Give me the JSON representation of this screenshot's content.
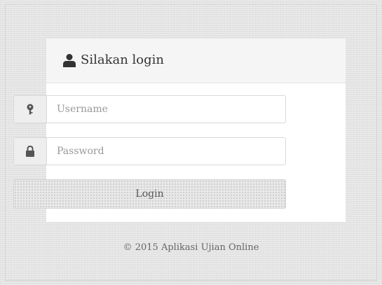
{
  "login_panel": {
    "header_icon": "user-icon",
    "title": "Silakan login"
  },
  "form": {
    "username": {
      "icon": "key-icon",
      "placeholder": "Username",
      "value": ""
    },
    "password": {
      "icon": "lock-icon",
      "placeholder": "Password",
      "value": ""
    },
    "login_label": "Login"
  },
  "footer": {
    "copyright": "© 2015 Aplikasi Ujian Online"
  },
  "colors": {
    "page_background": "#e3e3e3",
    "panel_background": "#ffffff",
    "header_background": "#f5f5f5",
    "addon_background": "#eeeeee",
    "button_background": "#e8e8e8",
    "text": "#333333"
  }
}
